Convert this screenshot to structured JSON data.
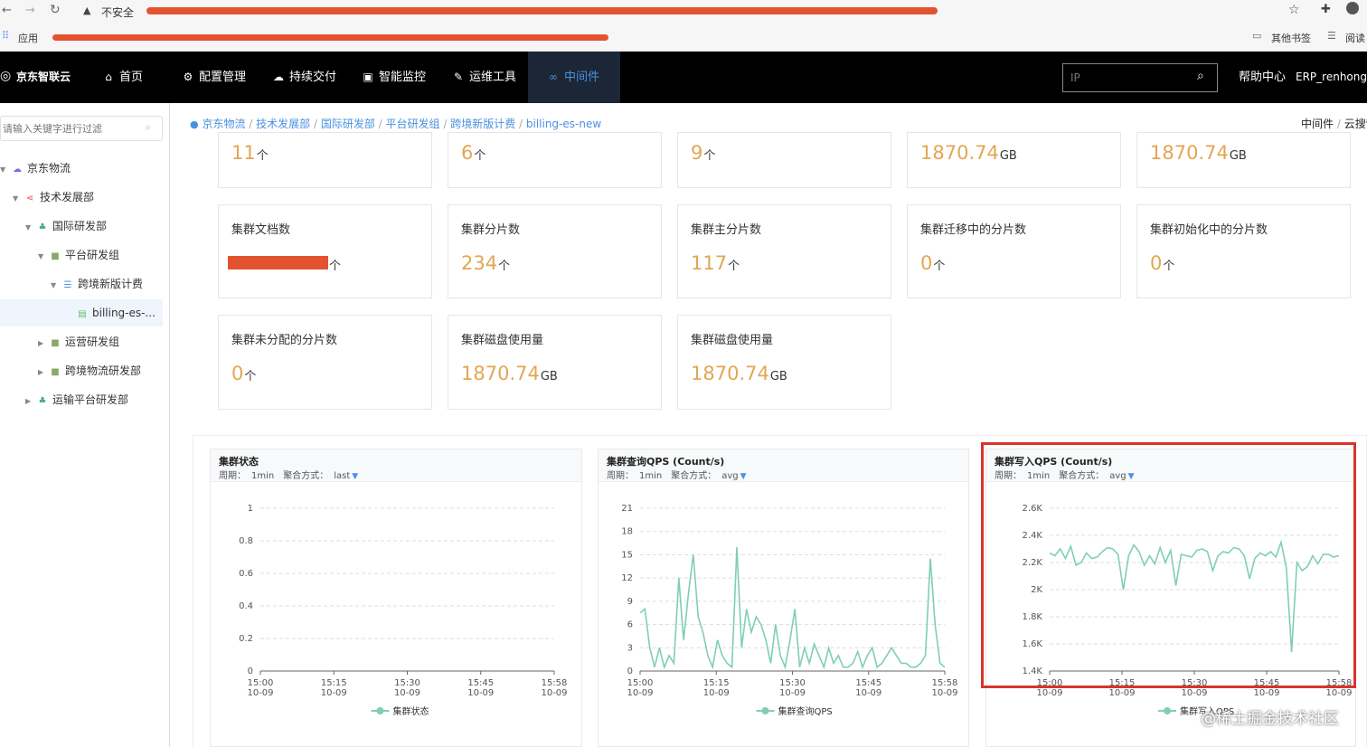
{
  "browser": {
    "insecure_label": "不安全"
  },
  "bookmarks": {
    "apps_label": "应用",
    "other_bookmarks": "其他书签",
    "reading_list": "阅读"
  },
  "topnav": {
    "brand": "京东智联云",
    "items": [
      {
        "label": "首页",
        "icon": "home-icon"
      },
      {
        "label": "配置管理",
        "icon": "gear-icon"
      },
      {
        "label": "持续交付",
        "icon": "cloud-icon"
      },
      {
        "label": "智能监控",
        "icon": "monitor-icon"
      },
      {
        "label": "运维工具",
        "icon": "edit-icon"
      },
      {
        "label": "中间件",
        "icon": "link-icon"
      }
    ],
    "search_placeholder": "IP",
    "help": "帮助中心",
    "user": "ERP_renhong..."
  },
  "sidebar": {
    "filter_placeholder": "请输入关键字进行过滤",
    "tree": [
      {
        "label": "京东物流"
      },
      {
        "label": "技术发展部"
      },
      {
        "label": "国际研发部"
      },
      {
        "label": "平台研发组"
      },
      {
        "label": "跨境新版计费"
      },
      {
        "label": "billing-es-..."
      },
      {
        "label": "运营研发组"
      },
      {
        "label": "跨境物流研发部"
      },
      {
        "label": "运输平台研发部"
      }
    ]
  },
  "breadcrumb": {
    "items": [
      "京东物流",
      "技术发展部",
      "国际研发部",
      "平台研发组",
      "跨境新版计费",
      "billing-es-new"
    ],
    "right_items": [
      "中间件",
      "云搜索"
    ]
  },
  "cards_row1": [
    {
      "value": "11",
      "unit": "个"
    },
    {
      "value": "6",
      "unit": "个"
    },
    {
      "value": "9",
      "unit": "个"
    },
    {
      "value": "1870.74",
      "unit": "GB"
    },
    {
      "value": "1870.74",
      "unit": "GB"
    }
  ],
  "cards_row2": [
    {
      "title": "集群文档数",
      "value": "",
      "unit": "个"
    },
    {
      "title": "集群分片数",
      "value": "234",
      "unit": "个"
    },
    {
      "title": "集群主分片数",
      "value": "117",
      "unit": "个"
    },
    {
      "title": "集群迁移中的分片数",
      "value": "0",
      "unit": "个"
    },
    {
      "title": "集群初始化中的分片数",
      "value": "0",
      "unit": "个"
    }
  ],
  "cards_row3": [
    {
      "title": "集群未分配的分片数",
      "value": "0",
      "unit": "个"
    },
    {
      "title": "集群磁盘使用量",
      "value": "1870.74",
      "unit": "GB"
    },
    {
      "title": "集群磁盘使用量",
      "value": "1870.74",
      "unit": "GB"
    }
  ],
  "panels": [
    {
      "title": "集群状态",
      "period_label": "周期：",
      "period": "1min",
      "agg_label": "聚合方式：",
      "agg": "last"
    },
    {
      "title": "集群查询QPS (Count/s)",
      "period_label": "周期：",
      "period": "1min",
      "agg_label": "聚合方式：",
      "agg": "avg"
    },
    {
      "title": "集群写入QPS (Count/s)",
      "period_label": "周期：",
      "period": "1min",
      "agg_label": "聚合方式：",
      "agg": "avg"
    }
  ],
  "watermark": "@稀土掘金技术社区",
  "colors": {
    "accent": "#1890ff",
    "line": "#7fcfb3",
    "value": "#e3a653",
    "highlight": "#d9342b"
  },
  "chart_data": [
    {
      "type": "line",
      "title": "集群状态",
      "x_ticks": [
        "15:00\n10-09",
        "15:15\n10-09",
        "15:30\n10-09",
        "15:45\n10-09",
        "15:58\n10-09"
      ],
      "y_ticks": [
        "0",
        "0.2",
        "0.4",
        "0.6",
        "0.8",
        "1"
      ],
      "ylim": [
        0,
        1
      ],
      "series": [
        {
          "name": "集群状态",
          "values": []
        }
      ]
    },
    {
      "type": "line",
      "title": "集群查询QPS (Count/s)",
      "x_ticks": [
        "15:00\n10-09",
        "15:15\n10-09",
        "15:30\n10-09",
        "15:45\n10-09",
        "15:58\n10-09"
      ],
      "y_ticks": [
        "0",
        "3",
        "6",
        "9",
        "12",
        "15",
        "18",
        "21"
      ],
      "ylim": [
        0,
        21
      ],
      "series": [
        {
          "name": "集群查询QPS",
          "values": [
            7.5,
            8,
            3,
            0.5,
            3,
            0.5,
            2,
            1,
            12,
            4,
            10,
            15,
            7,
            5,
            2,
            0.5,
            4,
            2,
            1,
            0.5,
            16,
            3,
            8,
            5,
            7,
            6,
            4,
            1,
            6,
            2,
            0.5,
            4,
            8,
            0.5,
            3,
            1,
            3.5,
            2,
            0.5,
            3,
            1,
            2,
            0.5,
            0.5,
            1,
            2.5,
            0.5,
            2,
            3,
            0.5,
            1,
            2,
            3,
            2,
            1,
            1,
            0.5,
            0.5,
            1,
            2,
            14.5,
            6,
            1,
            0.5
          ]
        }
      ]
    },
    {
      "type": "line",
      "title": "集群写入QPS (Count/s)",
      "x_ticks": [
        "15:00\n10-09",
        "15:15\n10-09",
        "15:30\n10-09",
        "15:45\n10-09",
        "15:58\n10-09"
      ],
      "y_ticks": [
        "1.4K",
        "1.6K",
        "1.8K",
        "2K",
        "2.2K",
        "2.4K",
        "2.6K"
      ],
      "ylim": [
        1400,
        2600
      ],
      "series": [
        {
          "name": "集群写入QPS",
          "values": [
            2270,
            2250,
            2300,
            2230,
            2320,
            2180,
            2200,
            2270,
            2230,
            2240,
            2280,
            2310,
            2300,
            2260,
            2000,
            2250,
            2330,
            2280,
            2180,
            2250,
            2190,
            2310,
            2200,
            2290,
            2030,
            2260,
            2250,
            2240,
            2290,
            2300,
            2280,
            2140,
            2250,
            2280,
            2270,
            2310,
            2300,
            2250,
            2080,
            2230,
            2270,
            2250,
            2280,
            2240,
            2350,
            2160,
            1540,
            2200,
            2140,
            2170,
            2250,
            2190,
            2260,
            2260,
            2240,
            2250
          ]
        }
      ]
    }
  ]
}
